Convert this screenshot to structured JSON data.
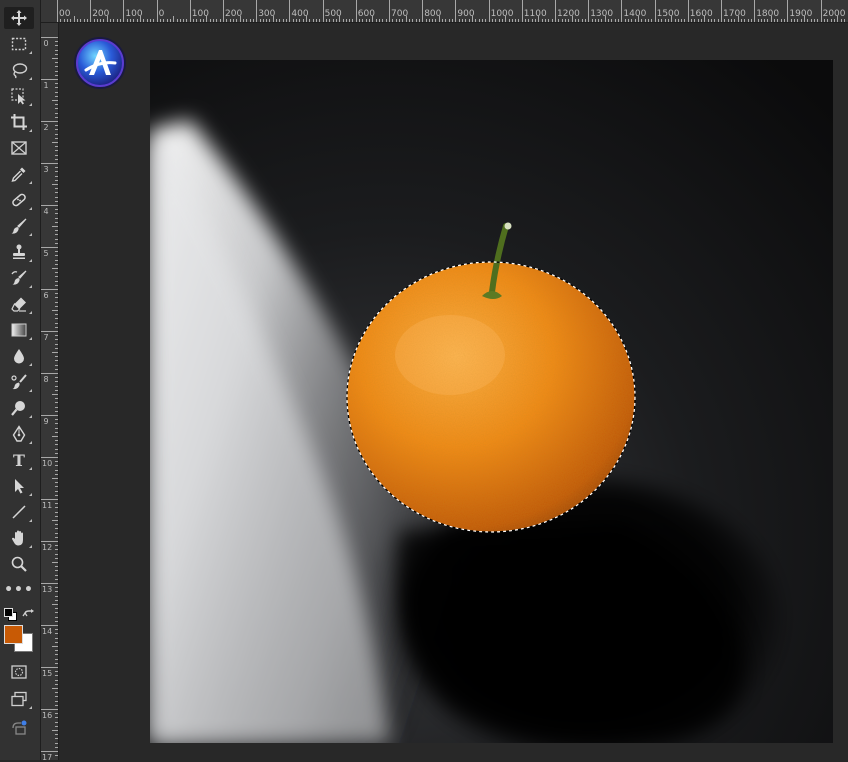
{
  "toolbar": {
    "tools": [
      {
        "name": "move-tool",
        "icon": "move-icon",
        "active": true
      },
      {
        "name": "marquee-tool",
        "icon": "rectangular-marquee-icon"
      },
      {
        "name": "lasso-tool",
        "icon": "lasso-icon"
      },
      {
        "name": "object-selection-tool",
        "icon": "object-selection-icon"
      },
      {
        "name": "crop-tool",
        "icon": "crop-icon"
      },
      {
        "name": "frame-tool",
        "icon": "frame-icon"
      },
      {
        "name": "eyedropper-tool",
        "icon": "eyedropper-icon"
      },
      {
        "name": "healing-brush-tool",
        "icon": "healing-bandage-icon"
      },
      {
        "name": "brush-tool",
        "icon": "brush-icon"
      },
      {
        "name": "clone-stamp-tool",
        "icon": "stamp-icon"
      },
      {
        "name": "history-brush-tool",
        "icon": "history-brush-icon"
      },
      {
        "name": "eraser-tool",
        "icon": "eraser-icon"
      },
      {
        "name": "gradient-tool",
        "icon": "gradient-icon"
      },
      {
        "name": "blur-tool",
        "icon": "drop-icon"
      },
      {
        "name": "dodge-tool",
        "icon": "dodge-icon"
      },
      {
        "name": "pen-tool",
        "icon": "pen-icon"
      },
      {
        "name": "type-tool",
        "icon": "type-icon",
        "glyph": "T"
      },
      {
        "name": "path-selection-tool",
        "icon": "arrow-cursor-icon"
      },
      {
        "name": "line-tool",
        "icon": "line-icon"
      },
      {
        "name": "hand-tool",
        "icon": "hand-icon"
      },
      {
        "name": "zoom-tool",
        "icon": "magnifier-icon"
      },
      {
        "name": "edit-toolbar",
        "icon": "more-dots-icon",
        "glyph": "•••"
      }
    ],
    "foreground_color": "#c85a05",
    "background_color": "#ffffff",
    "bottom_tools": [
      {
        "name": "quick-mask-mode",
        "icon": "quick-mask-icon"
      },
      {
        "name": "screen-mode",
        "icon": "screen-mode-icon"
      },
      {
        "name": "share",
        "icon": "share-icon"
      }
    ]
  },
  "ruler_top": {
    "labels": [
      "00",
      "200",
      "100",
      "0",
      "100",
      "200",
      "300",
      "400",
      "500",
      "600",
      "700",
      "800",
      "900",
      "1000",
      "1100",
      "1200",
      "1300",
      "1400",
      "1500",
      "1600",
      "1700",
      "1800",
      "1900",
      "2000"
    ]
  },
  "ruler_left": {
    "labels": [
      "0",
      "1",
      "2",
      "3",
      "4",
      "5",
      "6",
      "7",
      "8",
      "9",
      "10",
      "11",
      "12",
      "13",
      "14",
      "15",
      "16",
      "17"
    ]
  },
  "canvas": {
    "subject": "orange-with-selection",
    "selection": "marching-ants-around-orange"
  },
  "colors": {
    "accent_orange": "#c85a05",
    "panel": "#323232",
    "workspace": "#282828"
  }
}
